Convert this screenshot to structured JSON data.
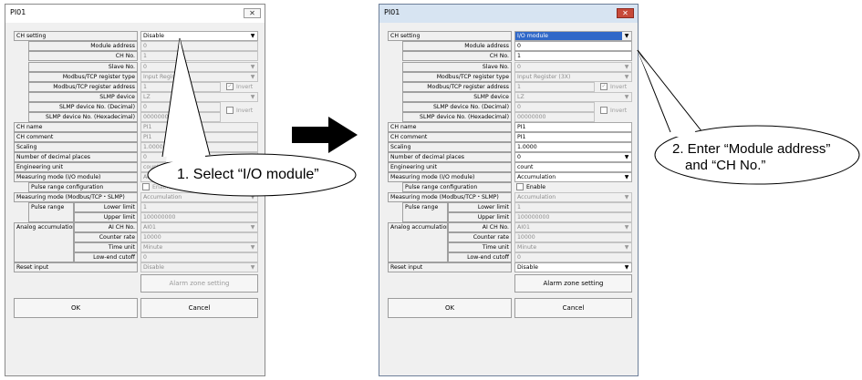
{
  "window_title": "PI01",
  "close_glyph": "✕",
  "dropdown_glyph": "▼",
  "check_glyph": "✓",
  "labels": {
    "ch_setting": "CH setting",
    "module_address": "Module address",
    "ch_no": "CH No.",
    "slave_no": "Slave No.",
    "modbus_reg_type": "Modbus/TCP register type",
    "modbus_reg_addr": "Modbus/TCP register address",
    "slmp_device": "SLMP device",
    "slmp_dev_dec": "SLMP device No. (Decimal)",
    "slmp_dev_hex": "SLMP device No. (Hexadecimal)",
    "ch_name": "CH name",
    "ch_comment": "CH comment",
    "scaling": "Scaling",
    "decimal_places": "Number of decimal places",
    "eng_unit": "Engineering unit",
    "meas_mode_io": "Measuring mode (I/O module)",
    "pulse_range_cfg": "Pulse range configuration",
    "meas_mode_modbus": "Measuring mode (Modbus/TCP・SLMP)",
    "pulse_range": "Pulse range",
    "lower_limit": "Lower limit",
    "upper_limit": "Upper limit",
    "analog_accum": "Analog accumulation",
    "ai_ch_no": "AI CH No.",
    "counter_rate": "Counter rate",
    "time_unit": "Time unit",
    "low_end_cutoff": "Low-end cutoff",
    "reset_input": "Reset input",
    "invert": "Invert",
    "enable": "Enable"
  },
  "buttons": {
    "alarm_zone": "Alarm zone setting",
    "ok": "OK",
    "cancel": "Cancel"
  },
  "left": {
    "ch_setting": "Disable",
    "module_address": "0",
    "ch_no": "1",
    "slave_no": "0",
    "modbus_reg_type": "Input Register",
    "modbus_reg_addr": "1",
    "slmp_device": "LZ",
    "slmp_dev_dec": "0",
    "slmp_dev_hex": "00000000",
    "ch_name": "PI1",
    "ch_comment": "PI1",
    "scaling": "1.0000",
    "decimal_places": "0",
    "eng_unit": "count",
    "meas_mode_io": "Accumulation",
    "meas_mode_modbus": "Accumulation",
    "lower_limit": "1",
    "upper_limit": "100000000",
    "ai_ch_no": "AI01",
    "counter_rate": "10000",
    "time_unit": "Minute",
    "low_end_cutoff": "0",
    "reset_input": "Disable"
  },
  "right": {
    "ch_setting": "I/O module",
    "module_address": "0",
    "ch_no": "1",
    "slave_no": "0",
    "modbus_reg_type": "Input Register (3X)",
    "modbus_reg_addr": "1",
    "slmp_device": "LZ",
    "slmp_dev_dec": "0",
    "slmp_dev_hex": "00000000",
    "ch_name": "PI1",
    "ch_comment": "PI1",
    "scaling": "1.0000",
    "decimal_places": "0",
    "eng_unit": "count",
    "meas_mode_io": "Accumulation",
    "meas_mode_modbus": "Accumulation",
    "lower_limit": "1",
    "upper_limit": "100000000",
    "ai_ch_no": "AI01",
    "counter_rate": "10000",
    "time_unit": "Minute",
    "low_end_cutoff": "0",
    "reset_input": "Disable"
  },
  "callouts": {
    "step1": "1. Select “I/O module”",
    "step2_line1": "2. Enter “Module address”",
    "step2_line2": "and “CH No.”"
  },
  "colors": {
    "selection": "#3068c8",
    "close_button_active": "#c74a3a",
    "arrow": "#000000"
  }
}
